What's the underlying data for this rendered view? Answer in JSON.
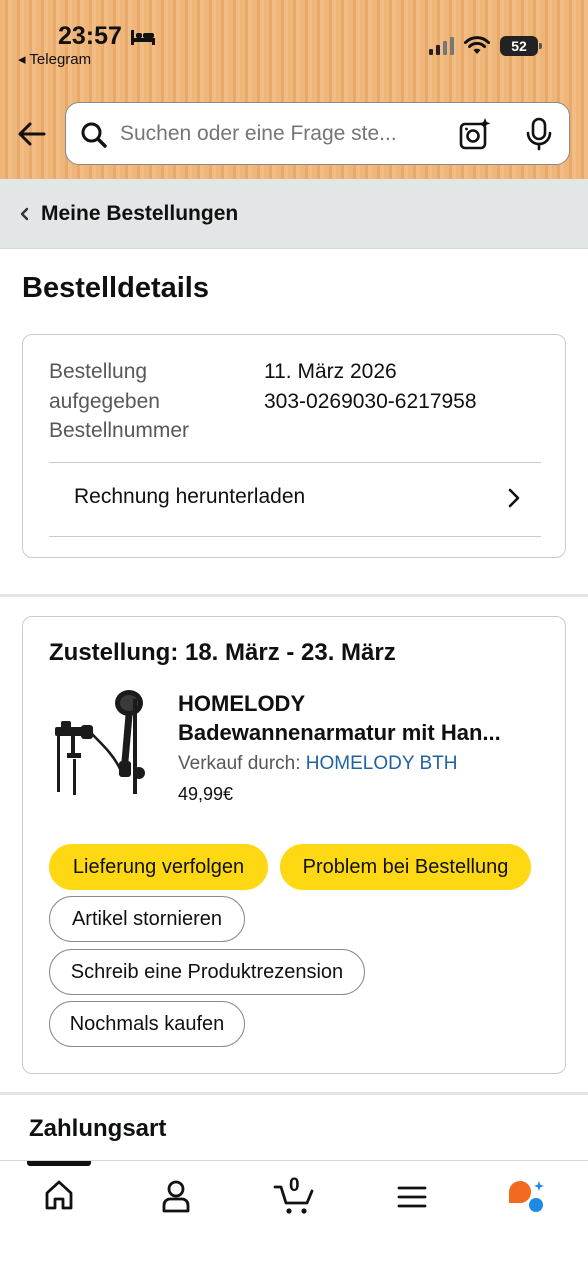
{
  "status_bar": {
    "time": "23:57",
    "back_app": "◂ Telegram",
    "battery": "52"
  },
  "search": {
    "placeholder": "Suchen oder eine Frage ste..."
  },
  "breadcrumb": {
    "label": "Meine Bestellungen"
  },
  "page": {
    "title": "Bestelldetails"
  },
  "order_info": {
    "label_placed_line1": "Bestellung",
    "label_placed_line2": "aufgegeben",
    "label_number": "Bestellnummer",
    "date": "11. März 2026",
    "number": "303-0269030-6217958",
    "invoice_label": "Rechnung herunterladen"
  },
  "delivery": {
    "title": "Zustellung: 18. März - 23. März",
    "product_title_line1": "HOMELODY",
    "product_title_line2": "Badewannenarmatur mit Han...",
    "seller_prefix": "Verkauf durch: ",
    "seller_name": "HOMELODY BTH",
    "price": "49,99€",
    "buttons": {
      "track": "Lieferung verfolgen",
      "problem": "Problem bei Bestellung",
      "cancel": "Artikel stornieren",
      "review": "Schreib eine Produktrezension",
      "buy_again": "Nochmals kaufen"
    }
  },
  "payment": {
    "title": "Zahlungsart"
  },
  "bottom_nav": {
    "cart_count": "0",
    "items": [
      "home-icon",
      "account-icon",
      "cart-icon",
      "menu-icon",
      "rufus-icon"
    ]
  },
  "colors": {
    "header_bg": "#f0b679",
    "button_yellow": "#ffd814",
    "link_blue": "#2162a1",
    "breadcrumb_bg": "#e3e6e6"
  }
}
